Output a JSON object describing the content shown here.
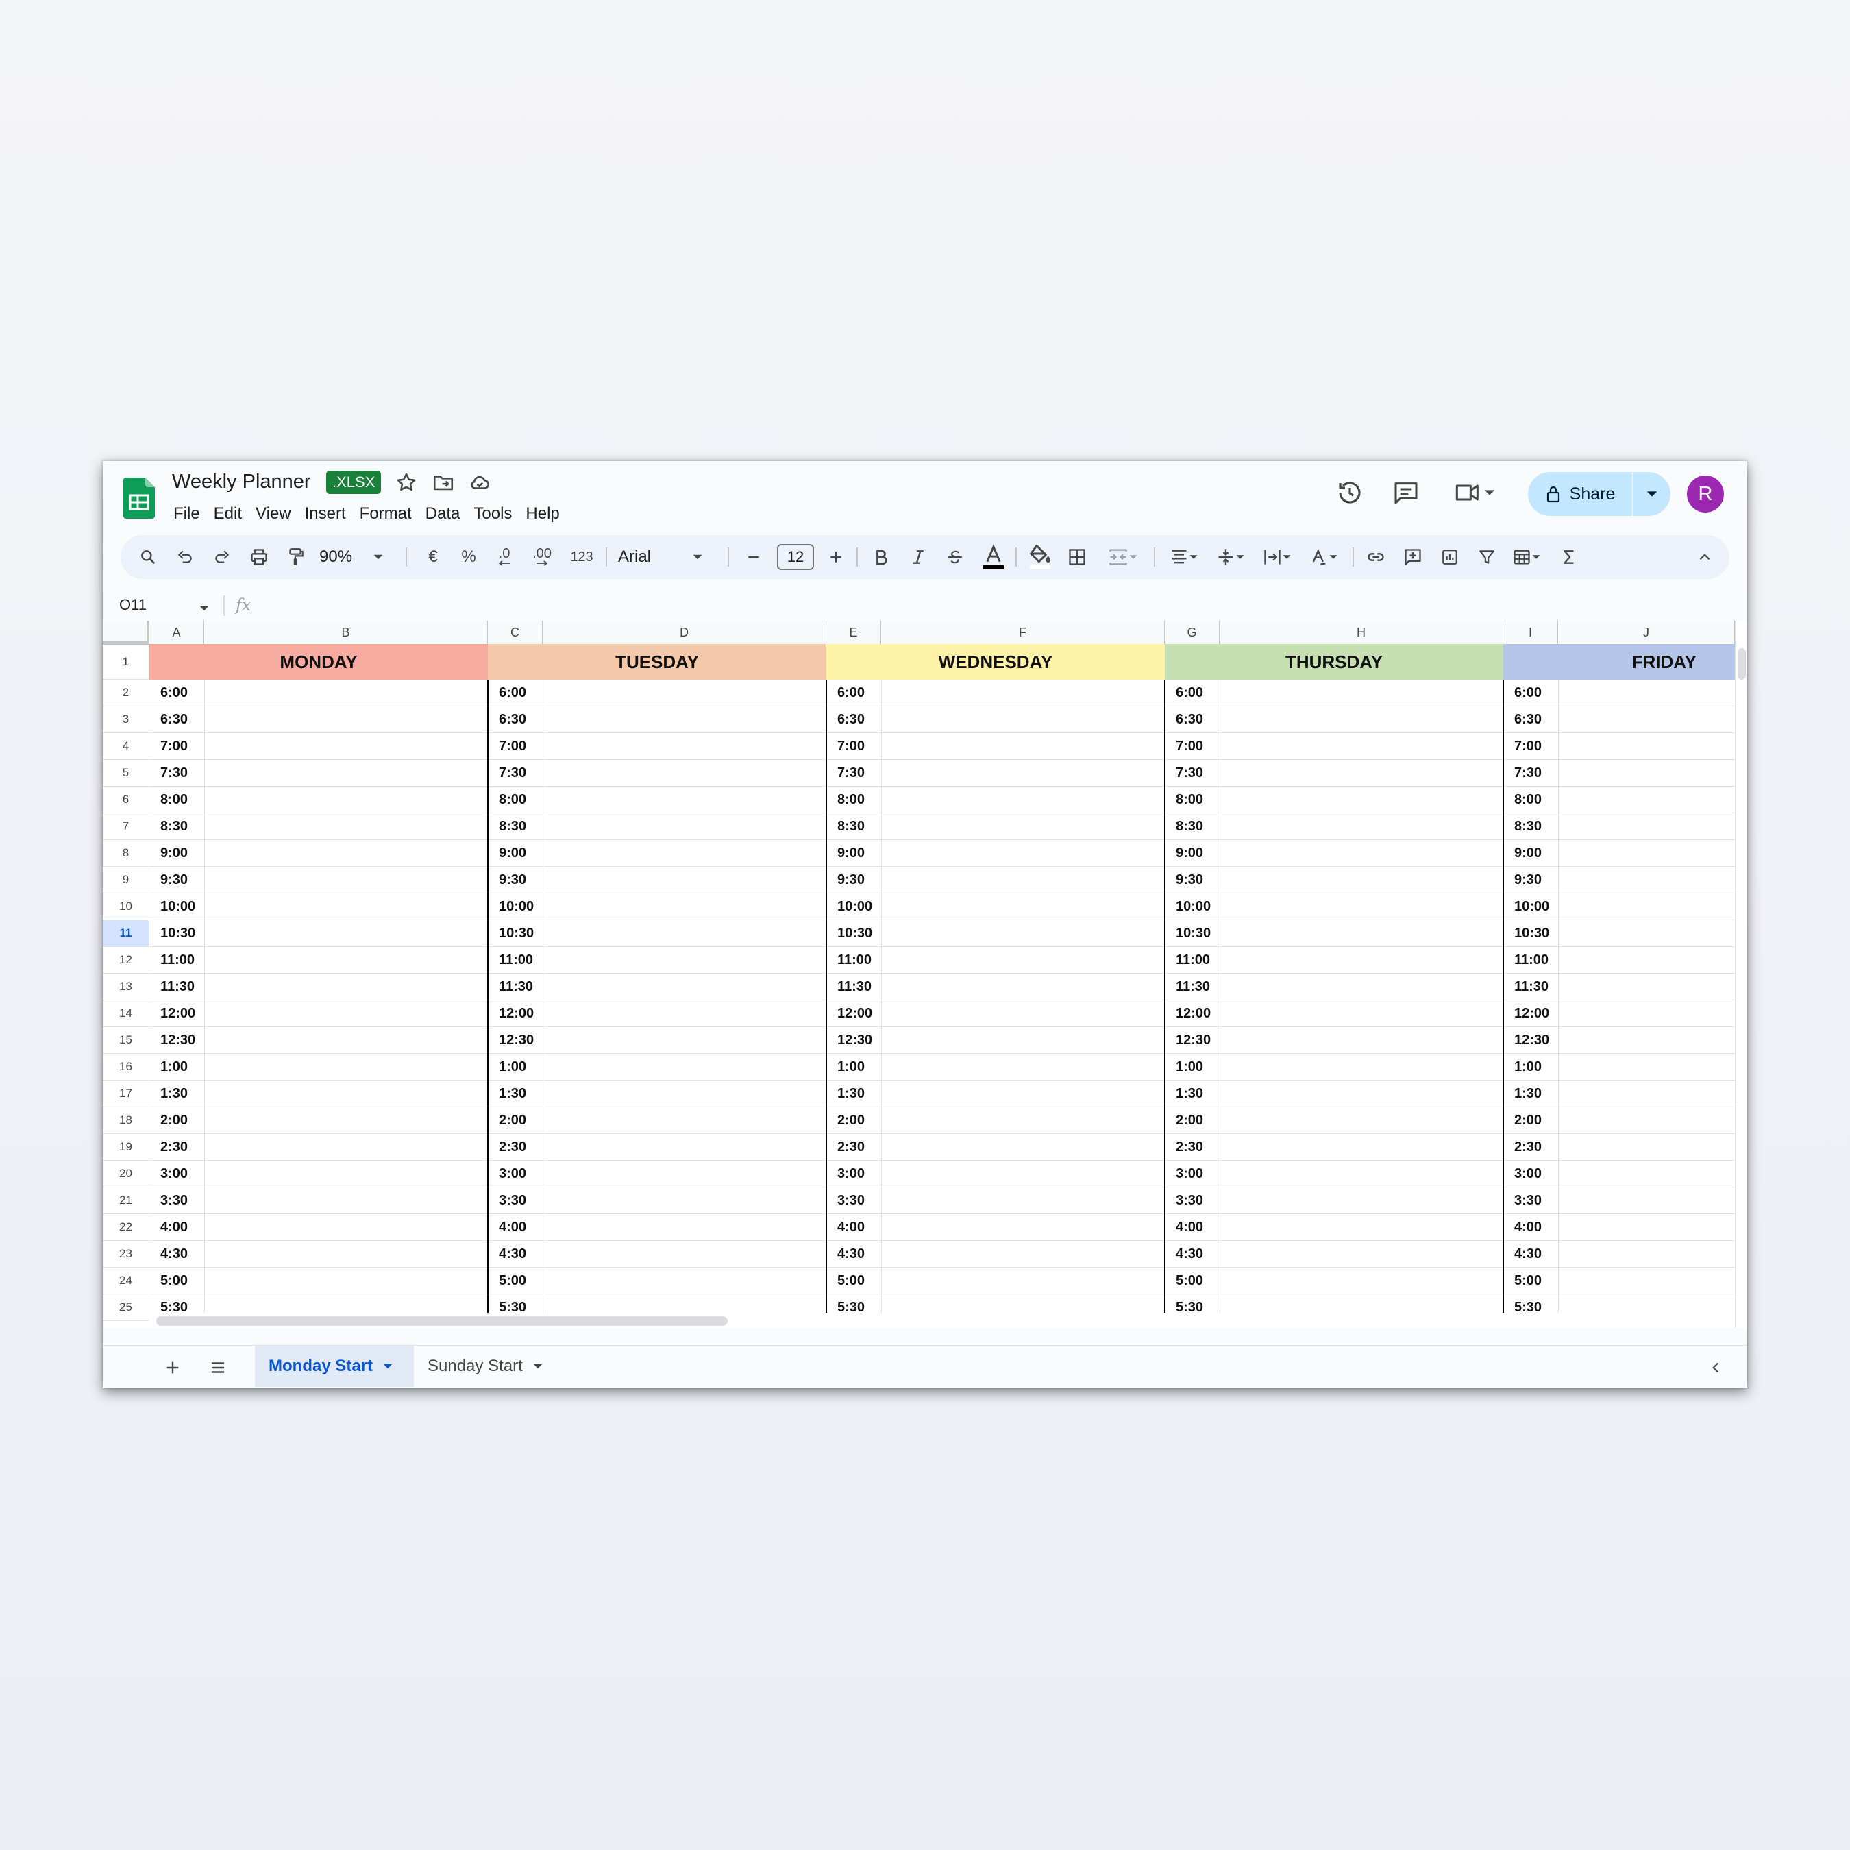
{
  "app": {
    "doc_title": "Weekly Planner",
    "file_badge": ".XLSX",
    "menu": [
      "File",
      "Edit",
      "View",
      "Insert",
      "Format",
      "Data",
      "Tools",
      "Help"
    ],
    "share_label": "Share",
    "avatar_letter": "R"
  },
  "toolbar": {
    "zoom": "90%",
    "currency": "€",
    "percent": "%",
    "decrease_decimal": ".0",
    "increase_decimal": ".00",
    "number_format": "123",
    "font": "Arial",
    "font_size": "12"
  },
  "formula_bar": {
    "name_box": "O11",
    "fx_label": "fx"
  },
  "grid": {
    "columns": [
      "A",
      "B",
      "C",
      "D",
      "E",
      "F",
      "G",
      "H",
      "I",
      "J"
    ],
    "rows": [
      "1",
      "2",
      "3",
      "4",
      "5",
      "6",
      "7",
      "8",
      "9",
      "10",
      "11",
      "12",
      "13",
      "14",
      "15",
      "16",
      "17",
      "18",
      "19",
      "20",
      "21",
      "22",
      "23",
      "24",
      "25"
    ],
    "active_row": "11",
    "days": [
      {
        "label": "MONDAY",
        "color": "#f8aca1"
      },
      {
        "label": "TUESDAY",
        "color": "#f6c8aa"
      },
      {
        "label": "WEDNESDAY",
        "color": "#fef2a9"
      },
      {
        "label": "THURSDAY",
        "color": "#c6e0b4"
      },
      {
        "label": "FRIDAY",
        "color": "#b4c6e7"
      }
    ],
    "times": [
      "6:00",
      "6:30",
      "7:00",
      "7:30",
      "8:00",
      "8:30",
      "9:00",
      "9:30",
      "10:00",
      "10:30",
      "11:00",
      "11:30",
      "12:00",
      "12:30",
      "1:00",
      "1:30",
      "2:00",
      "2:30",
      "3:00",
      "3:30",
      "4:00",
      "4:30",
      "5:00",
      "5:30"
    ]
  },
  "sheets": [
    {
      "label": "Monday Start",
      "active": true
    },
    {
      "label": "Sunday Start",
      "active": false
    }
  ],
  "icons": [
    "sheets-logo-icon",
    "star-icon",
    "move-folder-icon",
    "cloud-icon",
    "history-icon",
    "comment-icon",
    "meet-icon",
    "lock-icon",
    "search-icon",
    "undo-icon",
    "redo-icon",
    "print-icon",
    "paint-format-icon",
    "bold-icon",
    "italic-icon",
    "strikethrough-icon",
    "text-color-icon",
    "fill-color-icon",
    "borders-icon",
    "merge-icon",
    "align-icon",
    "valign-icon",
    "wrap-icon",
    "rotate-icon",
    "link-icon",
    "add-comment-icon",
    "chart-icon",
    "filter-icon",
    "table-icon",
    "sum-icon",
    "collapse-icon",
    "add-sheet-icon",
    "all-sheets-icon"
  ]
}
